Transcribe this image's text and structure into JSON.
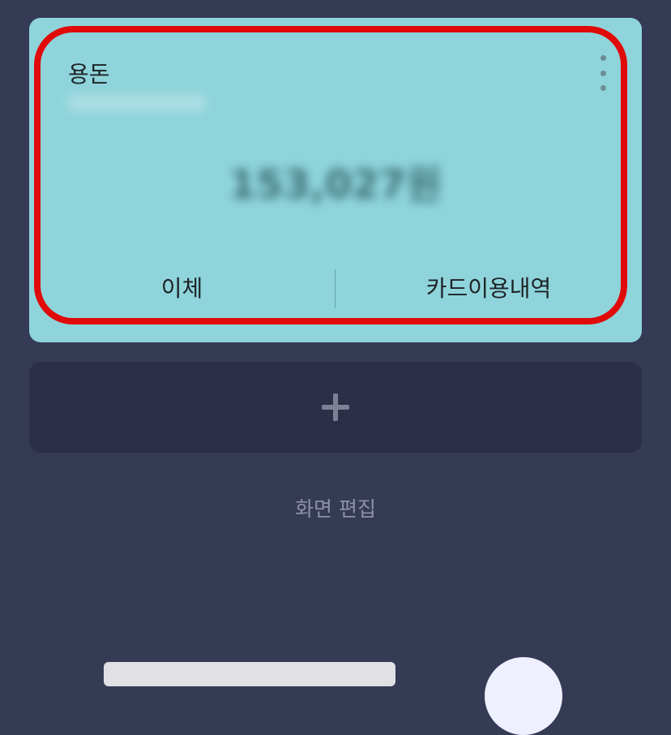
{
  "account_card": {
    "name": "용돈",
    "balance": "153,027원",
    "actions": {
      "transfer_label": "이체",
      "history_label": "카드이용내역"
    },
    "menu_icon": "more-vertical-icon"
  },
  "add_card": {
    "icon": "plus-icon"
  },
  "edit_screen_label": "화면 편집",
  "colors": {
    "background": "#353a55",
    "card": "#8fd4db",
    "add_card": "#2b2f48",
    "highlight": "#e00a0a"
  }
}
